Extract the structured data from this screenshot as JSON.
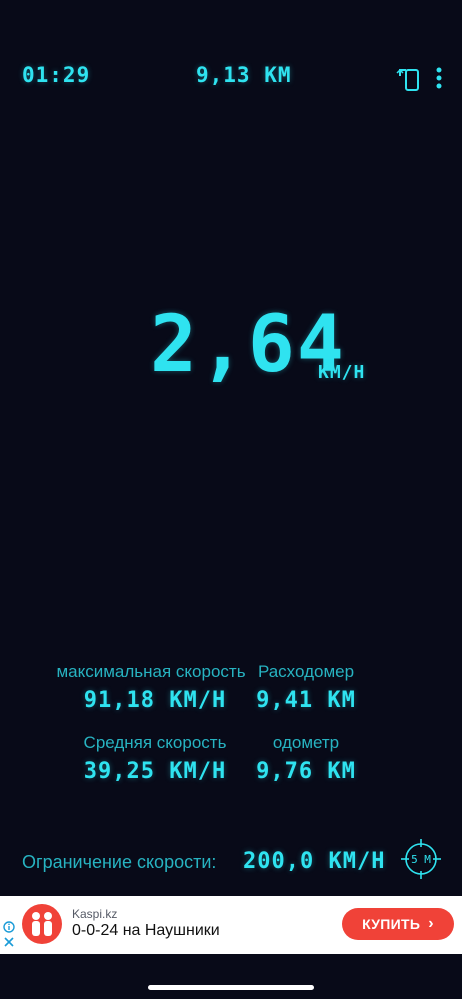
{
  "topbar": {
    "time": "01:29",
    "distance": "9,13 KM",
    "rotate_icon": "screen-rotate-icon",
    "menu_icon": "more-vertical-icon"
  },
  "speed": {
    "value": "2,64",
    "unit": "KM/H"
  },
  "stats": {
    "max_speed_label": "максимальная скорость",
    "max_speed_value": "91,18 KM/H",
    "trip_label": "Расходомер",
    "trip_value": "9,41 KM",
    "avg_speed_label": "Средняя скорость",
    "avg_speed_value": "39,25 KM/H",
    "odometer_label": "одометр",
    "odometer_value": "9,76 KM"
  },
  "limit": {
    "label": "Ограничение скорости:",
    "value": "200,0 KM/H",
    "icon_text": "5 M"
  },
  "ad": {
    "source": "Kaspi.kz",
    "title": "0-0-24 на Наушники",
    "button_label": "КУПИТЬ",
    "button_arrow": "›"
  },
  "colors": {
    "background": "#080a18",
    "digit": "#2fe3f0",
    "label": "#27b3c1",
    "ad_accent": "#f04238"
  }
}
